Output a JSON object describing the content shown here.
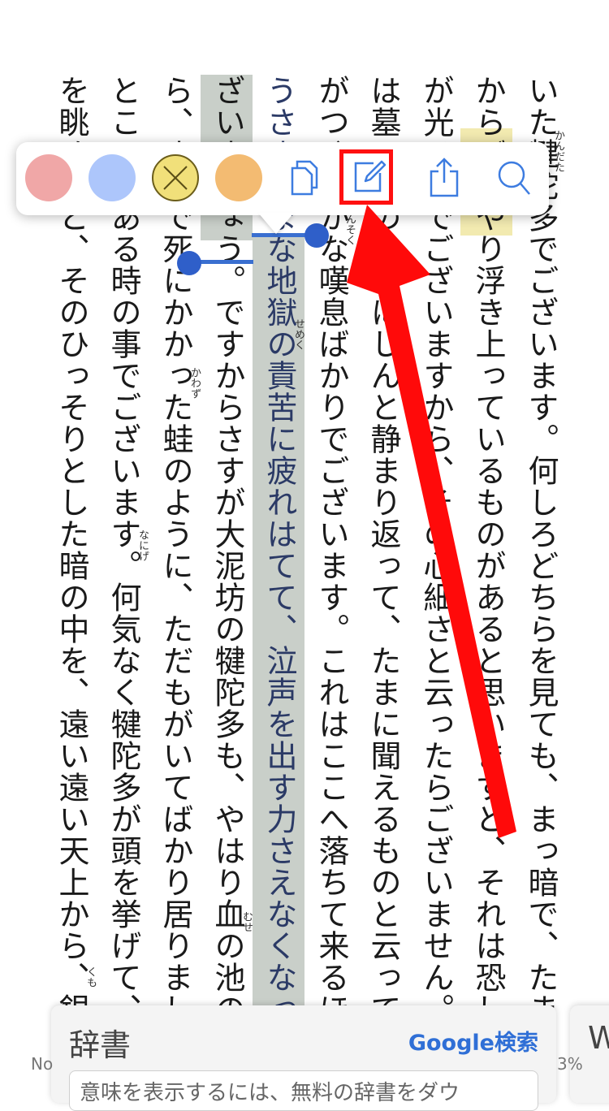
{
  "book": {
    "columns": [
      "いた犍陀多でございます。何しろどちらを見ても、まっ暗で、たまにそのくら",
      "からぼんやり浮き上っているものがあると思いますと、それは恐しい針の山の",
      "が光るのでございますから、その心細さと云ったらございません。その上あた",
      "は墓の中のようにしんと静まり返って、たまに聞えるものと云っては、ただ罪",
      "がつく微かな嘆息ばかりでございます。これはここへ落ちて来るほどの人間は、",
      "うさまざまな地獄の責苦に疲れはてて、泣声を出す力さえなくなっているので",
      "ざいましょう。ですからさすが大泥坊の犍陀多も、やはり血の池の血に咽びな",
      "ら、まるで死にかかった蛙のように、ただもがいてばかり居りました。",
      "ところがある時の事でございます。何気なく犍陀多が頭を挙げて、血の池の",
      "を眺めると、そのひっそりとした暗の中を、遠い遠い天上から、銀色の蜘蛛"
    ],
    "rubies": {
      "kandata": "かんだた",
      "tansoku": "たんそく",
      "semeku": "せめく",
      "kawazu": "かわず",
      "nanige": "なにげ",
      "muse": "むせ",
      "kumo": "くも"
    }
  },
  "toolbar": {
    "swatches": [
      {
        "name": "red",
        "color": "#f0a7a7"
      },
      {
        "name": "blue",
        "color": "#adc6fb"
      },
      {
        "name": "yellow",
        "color": "#f1e07a"
      },
      {
        "name": "orange",
        "color": "#f3bb72"
      }
    ],
    "icons": [
      "copy-icon",
      "note-edit-icon",
      "share-icon",
      "search-icon"
    ]
  },
  "dictionary": {
    "title": "辞書",
    "google_label": "Google検索",
    "body_text": "意味を表示するには、無料の辞書をダウ",
    "next_title": "W"
  },
  "footer": {
    "left": "No",
    "right": "3%"
  },
  "colors": {
    "accent": "#2f6fd6",
    "annotation": "#ff1010",
    "selection": "#c9cfc9"
  }
}
